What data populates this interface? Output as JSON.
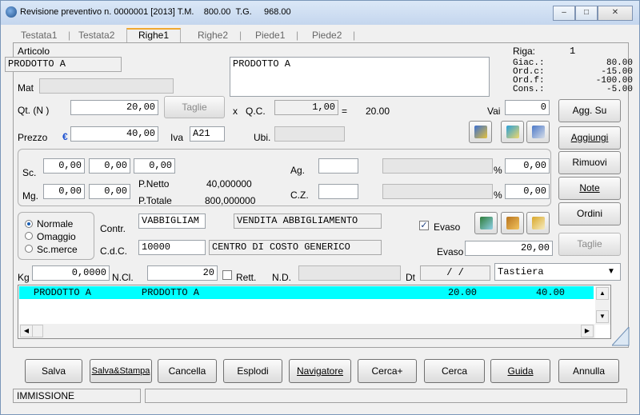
{
  "window": {
    "title": "Revisione preventivo n. 0000001 [2013]  T.M.",
    "tm_value": "800.00",
    "tg_label": "T.G.",
    "tg_value": "968.00"
  },
  "tabs": [
    "Testata1",
    "Testata2",
    "Righe1",
    "Righe2",
    "Piede1",
    "Piede2"
  ],
  "active_tab": "Righe1",
  "articolo": {
    "label": "Articolo",
    "code": "PRODOTTO A",
    "description": "PRODOTTO A",
    "mat_label": "Mat",
    "mat_value": ""
  },
  "riga": {
    "label": "Riga:",
    "value": "1",
    "giac_label": "Giac.:",
    "giac_value": "80.00",
    "ordc_label": "Ord.c:",
    "ordc_value": "-15.00",
    "ordf_label": "Ord.f:",
    "ordf_value": "-100.00",
    "cons_label": "Cons.:",
    "cons_value": "-5.00"
  },
  "quantity": {
    "label": "Qt.  (N )",
    "value": "20,00",
    "taglie_label": "Taglie",
    "x_label": "x",
    "qc_label": "Q.C.",
    "qc_value": "1,00",
    "eq_label": "=",
    "result": "20.00",
    "vai_label": "Vai",
    "vai_value": "0"
  },
  "price": {
    "label": "Prezzo",
    "currency": "€",
    "value": "40,00",
    "iva_label": "Iva",
    "iva_value": "A21",
    "ubi_label": "Ubi.",
    "ubi_value": ""
  },
  "discounts": {
    "sc_label": "Sc.",
    "sc_values": [
      "0,00",
      "0,00",
      "0,00"
    ],
    "mg_label": "Mg.",
    "mg_values": [
      "0,00",
      "0,00"
    ],
    "pnetto_label": "P.Netto",
    "pnetto_value": "40,000000",
    "ptotale_label": "P.Totale",
    "ptotale_value": "800,000000",
    "ag_label": "Ag.",
    "ag_value": "",
    "ag_pct": "0,00",
    "cz_label": "C.Z.",
    "cz_value": "",
    "cz_pct": "0,00",
    "pct_sign": "%"
  },
  "mode": {
    "options": [
      "Normale",
      "Omaggio",
      "Sc.merce"
    ],
    "selected": "Normale"
  },
  "contr": {
    "label": "Contr.",
    "code": "VABBIGLIAM",
    "description": "VENDITA ABBIGLIAMENTO"
  },
  "cdc": {
    "label": "C.d.C.",
    "code": "10000",
    "description": "CENTRO DI COSTO GENERICO"
  },
  "evaso": {
    "checkbox_label": "Evaso",
    "checked": true,
    "label": "Evaso",
    "value": "20,00"
  },
  "footer_fields": {
    "kg_label": "Kg",
    "kg_value": "0,0000",
    "ncl_label": "N.Cl.",
    "ncl_value": "20",
    "rett_label": "Rett.",
    "rett_checked": false,
    "nd_label": "N.D.",
    "nd_value": "",
    "dt_label": "Dt",
    "dt_value": "/    /",
    "input_mode": "Tastiera"
  },
  "side_buttons": {
    "agg_su": "Agg. Su",
    "aggiungi": "Aggiungi",
    "rimuovi": "Rimuovi",
    "note": "Note",
    "ordini": "Ordini",
    "taglie": "Taglie"
  },
  "grid": {
    "rows": [
      {
        "code": "PRODOTTO A",
        "description": "PRODOTTO A",
        "qty": "20.00",
        "price": "40.00"
      }
    ]
  },
  "bottom_buttons": [
    "Salva",
    "Salva&Stampa",
    "Cancella",
    "Esplodi",
    "Navigatore",
    "Cerca+",
    "Cerca",
    "Guida",
    "Annulla"
  ],
  "status": {
    "mode": "IMMISSIONE",
    "message": ""
  },
  "colors": {
    "grid_highlight": "#00ffff",
    "tab_accent": "#f0a830",
    "titlebar": "#c4d6ee"
  }
}
